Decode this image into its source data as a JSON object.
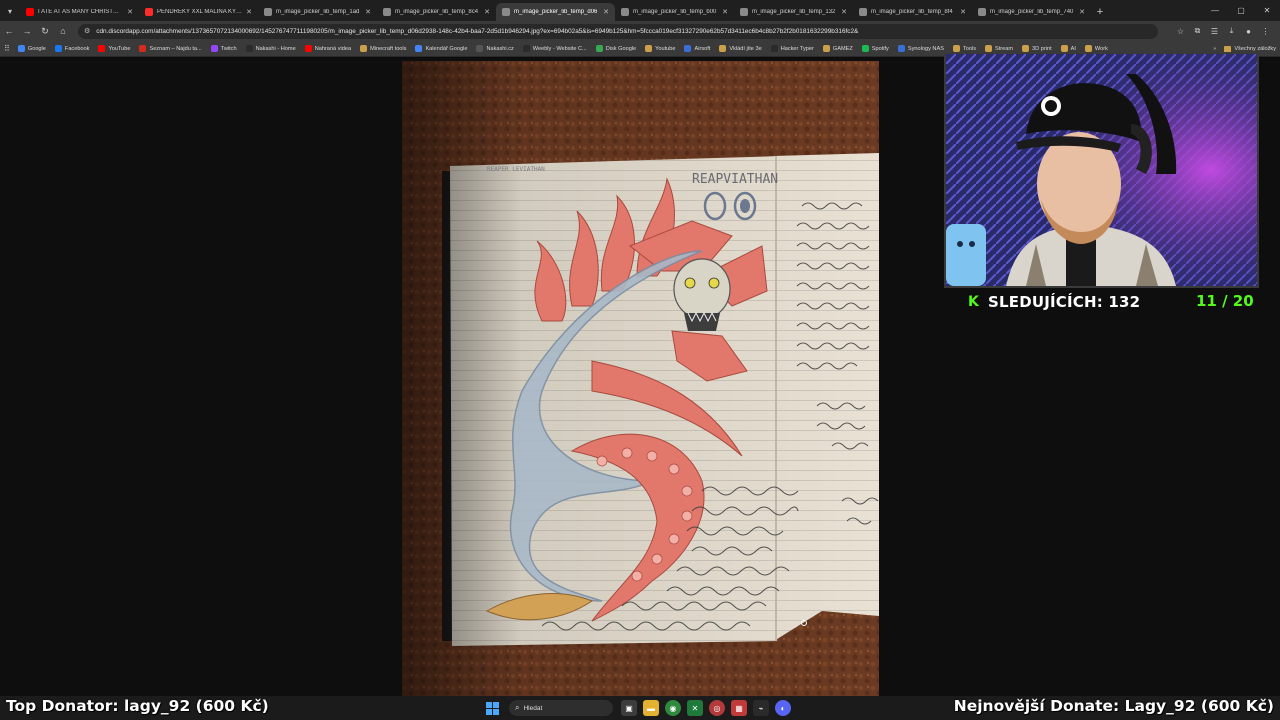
{
  "browser": {
    "tabs": [
      {
        "label": "I ATE AT AS MANY CHRISTMAS",
        "color": "#ff0000",
        "active": false
      },
      {
        "label": "PENDREKY XXL MALINA KYSE...",
        "color": "#ff2a2a",
        "active": false
      },
      {
        "label": "m_image_picker_lib_temp_1ad",
        "color": "#8a8a8a",
        "active": false
      },
      {
        "label": "m_image_picker_lib_temp_8c4",
        "color": "#8a8a8a",
        "active": false
      },
      {
        "label": "m_image_picker_lib_temp_d06",
        "color": "#8a8a8a",
        "active": true
      },
      {
        "label": "m_image_picker_lib_temp_b00",
        "color": "#8a8a8a",
        "active": false
      },
      {
        "label": "m_image_picker_lib_temp_132",
        "color": "#8a8a8a",
        "active": false
      },
      {
        "label": "m_image_picker_lib_temp_8f4",
        "color": "#8a8a8a",
        "active": false
      },
      {
        "label": "m_image_picker_lib_temp_740",
        "color": "#8a8a8a",
        "active": false
      }
    ],
    "url": "cdn.discordapp.com/attachments/1373657072134000692/1452767477111980205/m_image_picker_lib_temp_d06d2938-148c-42b4-baa7-2d5d1b946294.jpg?ex=694b02a5&is=6949b125&hm=5fccca019ecf31327290e62b57d3411ec6b4c8b27b2f2b0181632299b316fc2&",
    "bookmarks": [
      {
        "label": "Google",
        "color": "#4285f4"
      },
      {
        "label": "Facebook",
        "color": "#1877f2"
      },
      {
        "label": "YouTube",
        "color": "#ff0000"
      },
      {
        "label": "Seznam – Najdu ta...",
        "color": "#d52b1e"
      },
      {
        "label": "Twitch",
        "color": "#9146ff"
      },
      {
        "label": "Nakashi - Home",
        "color": "#2b2b2b"
      },
      {
        "label": "Nahraná videa",
        "color": "#ff0000"
      },
      {
        "label": "Minecraft tools",
        "color": "#caa14a"
      },
      {
        "label": "Kalendář Google",
        "color": "#4285f4"
      },
      {
        "label": "Nakashi.cz",
        "color": "#555555"
      },
      {
        "label": "Weebly - Website C...",
        "color": "#2b2b2b"
      },
      {
        "label": "Disk Google",
        "color": "#34a853"
      },
      {
        "label": "Youtube",
        "color": "#caa14a"
      },
      {
        "label": "Airsoft",
        "color": "#3b6fd8"
      },
      {
        "label": "Vkládí jíte 3e",
        "color": "#caa14a"
      },
      {
        "label": "Hacker Typer",
        "color": "#2b2b2b"
      },
      {
        "label": "GAMEZ",
        "color": "#caa14a"
      },
      {
        "label": "Spotify",
        "color": "#1db954"
      },
      {
        "label": "Synology NAS",
        "color": "#3b6fd8"
      },
      {
        "label": "Tools",
        "color": "#caa14a"
      },
      {
        "label": "Stream",
        "color": "#caa14a"
      },
      {
        "label": "3D print",
        "color": "#caa14a"
      },
      {
        "label": "AI",
        "color": "#caa14a"
      },
      {
        "label": "Work",
        "color": "#caa14a"
      }
    ],
    "all_bookmarks": "Všechny záložky"
  },
  "overlay": {
    "viewers_label": "SLEDUJÍCÍCH: 132",
    "goal": "11 / 20",
    "kick_icon": "K",
    "top_donator": "Top Donator: lagy_92 (600 Kč)",
    "latest_donate": "Nejnovější Donate: Lagy_92 (600 Kč)"
  },
  "drawing": {
    "title": "REAPVIATHAN",
    "corner_label": "REAPER LEVIATHAN"
  },
  "taskbar": {
    "search_placeholder": "Hledat"
  },
  "colors": {
    "kick_green": "#53fc18",
    "tab_bar": "#1f1f1f",
    "toolbar": "#3a3a3a"
  }
}
